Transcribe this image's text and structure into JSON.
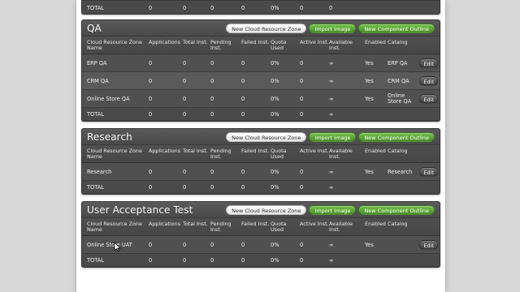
{
  "top_total": {
    "label": "TOTAL",
    "values": [
      "0",
      "0",
      "0",
      "0",
      "0%",
      "0",
      "0"
    ]
  },
  "sections": [
    {
      "title": "QA",
      "buttons": {
        "new_zone": "New Cloud Resource Zone",
        "import_image": "Import Image",
        "new_component": "New Component Outline"
      },
      "headers": [
        "Cloud Resource Zone Name",
        "Applications",
        "Total Inst.",
        "Pending Inst.",
        "Failed Inst.",
        "Quota Used",
        "Active Inst.",
        "Available Inst.",
        "Enabled",
        "Catalog",
        ""
      ],
      "rows": [
        {
          "name": "ERP QA",
          "applications": "0",
          "total": "0",
          "pending": "0",
          "failed": "0",
          "quota": "0%",
          "active": "0",
          "available": "∞",
          "enabled": "Yes",
          "catalog": "ERP QA",
          "edit": "Edit"
        },
        {
          "name": "CRM QA",
          "applications": "0",
          "total": "0",
          "pending": "0",
          "failed": "0",
          "quota": "0%",
          "active": "0",
          "available": "∞",
          "enabled": "Yes",
          "catalog": "CRM QA",
          "edit": "Edit"
        },
        {
          "name": "Online Store QA",
          "applications": "0",
          "total": "0",
          "pending": "0",
          "failed": "0",
          "quota": "0%",
          "active": "0",
          "available": "∞",
          "enabled": "Yes",
          "catalog": "Online Store QA",
          "edit": "Edit"
        }
      ],
      "total": {
        "label": "TOTAL",
        "applications": "0",
        "total": "0",
        "pending": "0",
        "failed": "0",
        "quota": "0%",
        "active": "0",
        "available": "∞"
      }
    },
    {
      "title": "Research",
      "buttons": {
        "new_zone": "New Cloud Resource Zone",
        "import_image": "Import Image",
        "new_component": "New Component Outline"
      },
      "headers": [
        "Cloud Resource Zone Name",
        "Applications",
        "Total Inst.",
        "Pending Inst.",
        "Failed Inst.",
        "Quota Used",
        "Active Inst.",
        "Available Inst.",
        "Enabled",
        "Catalog",
        ""
      ],
      "rows": [
        {
          "name": "Research",
          "applications": "0",
          "total": "0",
          "pending": "0",
          "failed": "0",
          "quota": "0%",
          "active": "0",
          "available": "∞",
          "enabled": "Yes",
          "catalog": "Research",
          "edit": "Edit"
        }
      ],
      "total": {
        "label": "TOTAL",
        "applications": "0",
        "total": "0",
        "pending": "0",
        "failed": "0",
        "quota": "0%",
        "active": "0",
        "available": "∞"
      }
    },
    {
      "title": "User Acceptance Test",
      "buttons": {
        "new_zone": "New Cloud Resource Zone",
        "import_image": "Import Image",
        "new_component": "New Component Outline"
      },
      "headers": [
        "Cloud Resource Zone Name",
        "Applications",
        "Total Inst.",
        "Pending Inst.",
        "Failed Inst.",
        "Quota Used",
        "Active Inst.",
        "Available Inst.",
        "Enabled",
        "Catalog",
        ""
      ],
      "rows": [
        {
          "name": "Online Store UAT",
          "applications": "0",
          "total": "0",
          "pending": "0",
          "failed": "0",
          "quota": "0%",
          "active": "0",
          "available": "∞",
          "enabled": "Yes",
          "catalog": "",
          "edit": "Edit"
        }
      ],
      "total": {
        "label": "TOTAL",
        "applications": "0",
        "total": "0",
        "pending": "0",
        "failed": "0",
        "quota": "0%",
        "active": "0",
        "available": "∞"
      }
    }
  ]
}
